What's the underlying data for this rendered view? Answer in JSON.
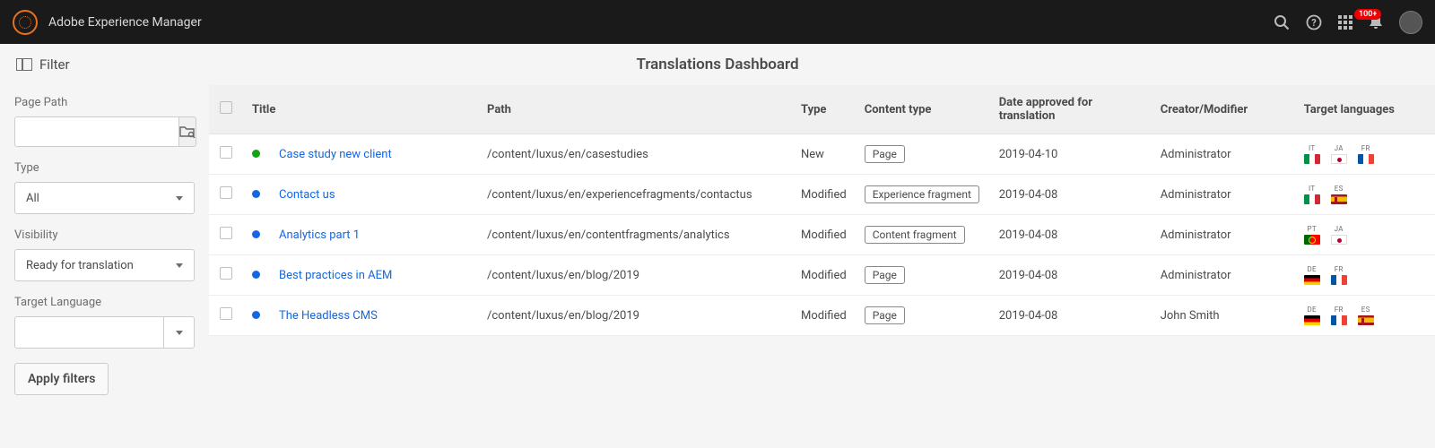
{
  "topbar": {
    "brand": "Adobe Experience Manager",
    "notification_badge": "100+"
  },
  "subheader": {
    "filter_label": "Filter",
    "page_title": "Translations Dashboard"
  },
  "sidebar": {
    "page_path": {
      "label": "Page Path",
      "value": ""
    },
    "type": {
      "label": "Type",
      "value": "All"
    },
    "visibility": {
      "label": "Visibility",
      "value": "Ready for translation"
    },
    "target_language": {
      "label": "Target Language",
      "value": ""
    },
    "apply_label": "Apply filters"
  },
  "table": {
    "headers": {
      "title": "Title",
      "path": "Path",
      "type": "Type",
      "content_type": "Content type",
      "date": "Date approved for translation",
      "creator": "Creator/Modifier",
      "target_langs": "Target languages"
    },
    "rows": [
      {
        "status": "new",
        "title": "Case study new client",
        "path": "/content/luxus/en/casestudies",
        "type": "New",
        "content_type": "Page",
        "date": "2019-04-10",
        "creator": "Administrator",
        "langs": [
          "IT",
          "JA",
          "FR"
        ]
      },
      {
        "status": "modified",
        "title": "Contact us",
        "path": "/content/luxus/en/experiencefragments/contactus",
        "type": "Modified",
        "content_type": "Experience fragment",
        "date": "2019-04-08",
        "creator": "Administrator",
        "langs": [
          "IT",
          "ES"
        ]
      },
      {
        "status": "modified",
        "title": "Analytics part 1",
        "path": "/content/luxus/en/contentfragments/analytics",
        "type": "Modified",
        "content_type": "Content fragment",
        "date": "2019-04-08",
        "creator": "Administrator",
        "langs": [
          "PT",
          "JA"
        ]
      },
      {
        "status": "modified",
        "title": "Best practices in AEM",
        "path": "/content/luxus/en/blog/2019",
        "type": "Modified",
        "content_type": "Page",
        "date": "2019-04-08",
        "creator": "Administrator",
        "langs": [
          "DE",
          "FR"
        ]
      },
      {
        "status": "modified",
        "title": "The Headless CMS",
        "path": "/content/luxus/en/blog/2019",
        "type": "Modified",
        "content_type": "Page",
        "date": "2019-04-08",
        "creator": "John Smith",
        "langs": [
          "DE",
          "FR",
          "ES"
        ]
      }
    ]
  }
}
